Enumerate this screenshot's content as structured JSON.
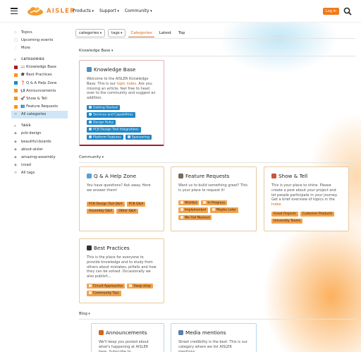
{
  "header": {
    "brand": "AISLER",
    "nav": [
      "Products",
      "Support",
      "Community"
    ],
    "login_label": "Log In"
  },
  "sidebar": {
    "top_items": [
      "Topics",
      "Upcoming events",
      "More"
    ],
    "categories_heading": "CATEGORIES",
    "categories": [
      {
        "label": "📖 Knowledge Base",
        "color": "#a31d2b"
      },
      {
        "label": "🎓 Best Practices",
        "color": "#f7941d"
      },
      {
        "label": "❓ Q & A Help Zone",
        "color": "#0b8fd1"
      },
      {
        "label": "📢 Announcements",
        "color": "#f7941d"
      },
      {
        "label": "🚀 Show & Tell",
        "color": "#f7941d"
      },
      {
        "label": "👥 Feature Requests",
        "color": "#f7941d"
      },
      {
        "label": "All categories",
        "color": ""
      }
    ],
    "tags_heading": "TAGS",
    "tags": [
      "pcb-design",
      "beautiful-boards",
      "about-aisler",
      "amazing-assembly",
      "icoad",
      "All tags"
    ]
  },
  "toolbar": {
    "categories_dd": "categories",
    "tags_dd": "tags",
    "tabs": [
      "Categories",
      "Latest",
      "Top"
    ]
  },
  "sections": {
    "knowledge": "Knowledge Base",
    "community": "Community",
    "blog": "Blog"
  },
  "cards": {
    "kb": {
      "title": "Knowledge Base",
      "desc_pre": "Welcome to the AISLER Knowledge Base. This is our ",
      "desc_link": "topic index",
      "desc_post": ". Are you missing an article, feel free to head over to the community and suggest an addition.",
      "chips": [
        "Getting Started",
        "Services and Capabilities",
        "Design Rules",
        "PCB Design Tool Integrations",
        "Platform Features",
        "Sponsoring"
      ]
    },
    "qa": {
      "title": "Q & A Help Zone",
      "desc": "You have questions? Ask away. Here we answer them!",
      "chips": [
        "PCB Design Tool Q&A",
        "PCB Q&A",
        "Assembly Q&A",
        "Other Q&A"
      ]
    },
    "fr": {
      "title": "Feature Requests",
      "desc": "Want us to build something great? This is your place to request it!",
      "chips": [
        "Wishlist",
        "In Progress",
        "Implemented",
        "Maybe Later",
        "We Got Nearest"
      ]
    },
    "st": {
      "title": "Show & Tell",
      "desc_pre": "This is your place to shine. Please create a post about your project and let people participate in your journey. Get a brief overview of topics in the ",
      "desc_link": "Index",
      "chips": [
        "Great Projects",
        "Customer Products",
        "University Teams"
      ]
    },
    "bp": {
      "title": "Best Practices",
      "desc": "This is the place for everyone to provide knowledge and to study from others about mistakes, pitfalls and how they can be solved. Occasionally we also publish…",
      "chips": [
        "Circuit Approaches",
        "Swap shop",
        "Community Tips"
      ]
    },
    "ann": {
      "title": "Announcements",
      "desc": "We'll keep you posted about what's happening at AISLER here. Subscribe to"
    },
    "media": {
      "title": "Media mentions",
      "desc": "Street credibility is the best. This is our category where we list AISLER mentions"
    }
  }
}
